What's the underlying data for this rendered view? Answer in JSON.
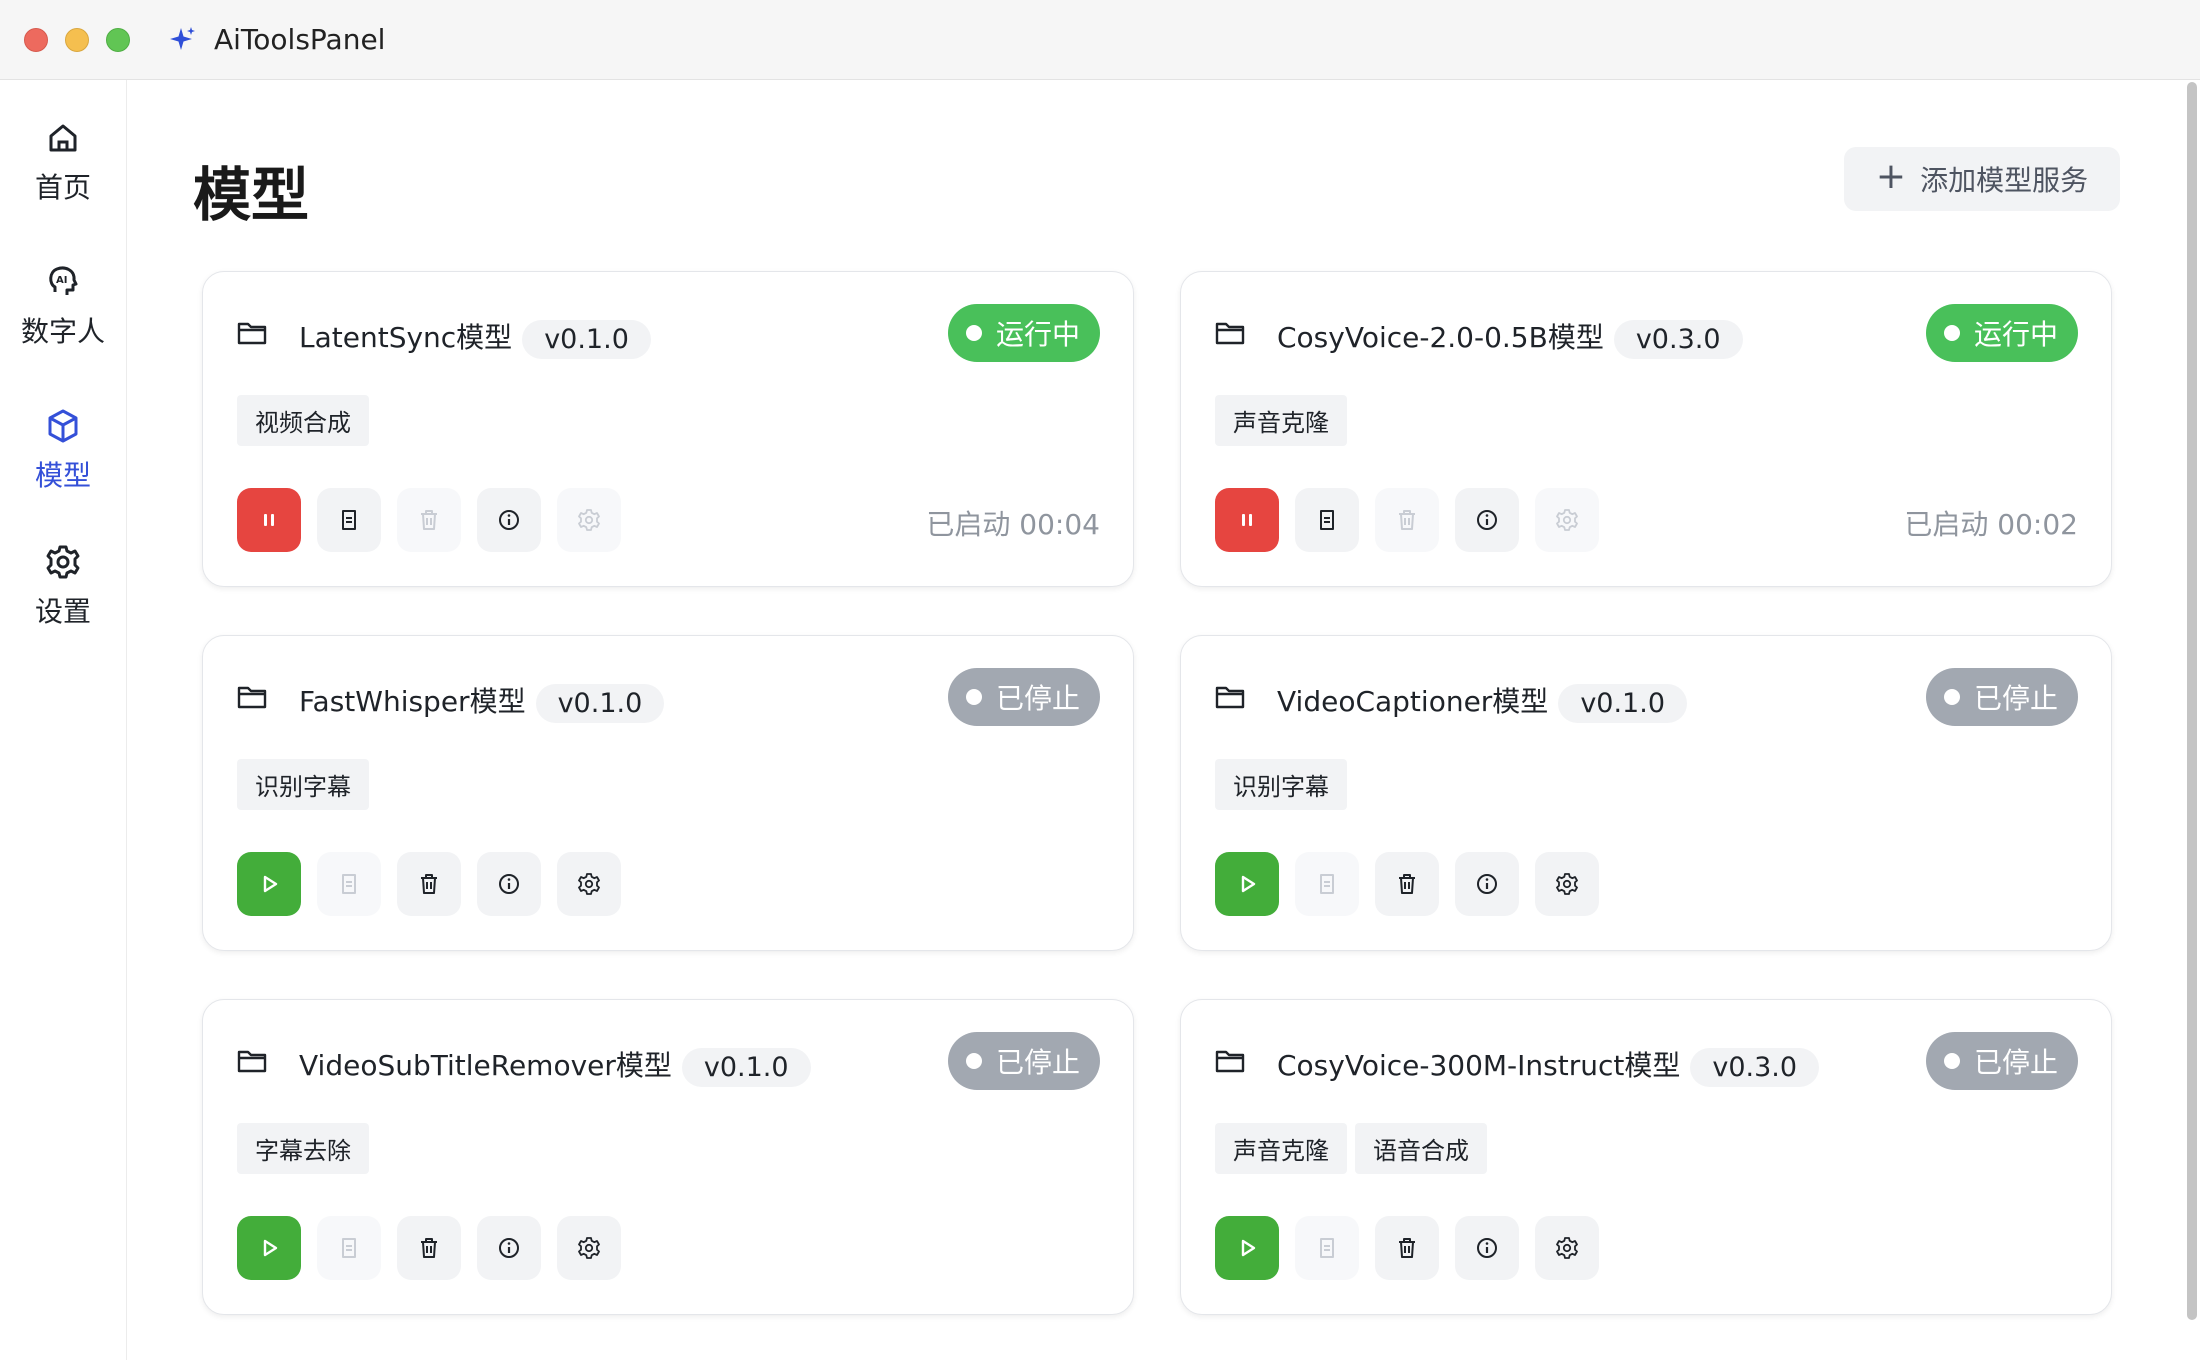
{
  "app": {
    "title": "AiToolsPanel"
  },
  "sidebar": {
    "items": [
      {
        "label": "首页",
        "icon": "home-icon",
        "active": false
      },
      {
        "label": "数字人",
        "icon": "ai-head-icon",
        "active": false
      },
      {
        "label": "模型",
        "icon": "cube-icon",
        "active": true
      },
      {
        "label": "设置",
        "icon": "gear-icon",
        "active": false
      }
    ]
  },
  "main": {
    "title": "模型",
    "add_button": {
      "plus": "+",
      "label": "添加模型服务"
    }
  },
  "colors": {
    "accent": "#3450d8",
    "running": "#49c05a",
    "stopped": "#a2a8b1",
    "pause_button": "#e64540",
    "play_button": "#43ad3a"
  },
  "cards": [
    {
      "name": "LatentSync模型",
      "version": "v0.1.0",
      "status": "运行中",
      "running": true,
      "tags": [
        "视频合成"
      ],
      "uptime": "已启动 00:04"
    },
    {
      "name": "CosyVoice-2.0-0.5B模型",
      "version": "v0.3.0",
      "status": "运行中",
      "running": true,
      "tags": [
        "声音克隆"
      ],
      "uptime": "已启动 00:02"
    },
    {
      "name": "FastWhisper模型",
      "version": "v0.1.0",
      "status": "已停止",
      "running": false,
      "tags": [
        "识别字幕"
      ],
      "uptime": ""
    },
    {
      "name": "VideoCaptioner模型",
      "version": "v0.1.0",
      "status": "已停止",
      "running": false,
      "tags": [
        "识别字幕"
      ],
      "uptime": ""
    },
    {
      "name": "VideoSubTitleRemover模型",
      "version": "v0.1.0",
      "status": "已停止",
      "running": false,
      "tags": [
        "字幕去除"
      ],
      "uptime": ""
    },
    {
      "name": "CosyVoice-300M-Instruct模型",
      "version": "v0.3.0",
      "status": "已停止",
      "running": false,
      "tags": [
        "声音克隆",
        "语音合成"
      ],
      "uptime": ""
    }
  ]
}
